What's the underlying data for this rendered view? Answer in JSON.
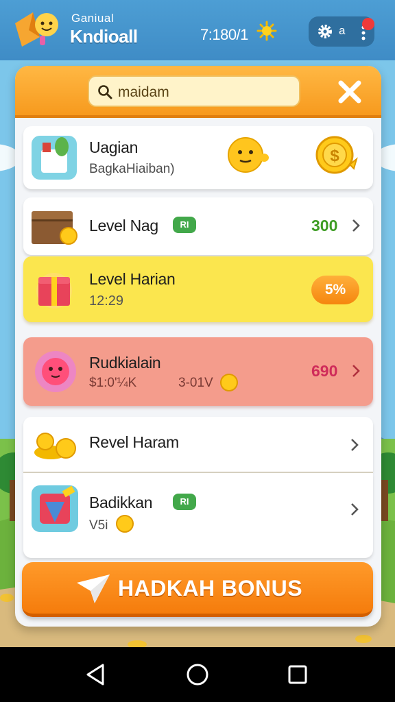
{
  "header": {
    "title_small": "Ganiual",
    "title_big": "Kndioall",
    "coins": "7:180/1",
    "settings_label": "a",
    "icons": [
      "app-logo-icon",
      "sun-icon",
      "gear-icon",
      "more-icon"
    ]
  },
  "panel": {
    "search": {
      "value": "maidam",
      "icon": "search-icon"
    },
    "close_icon": "close-icon",
    "items": [
      {
        "title": "Uagian",
        "subtitle": "BagkaHiaiban)",
        "style": "white",
        "icons": [
          "cup-icon",
          "smiley-icon",
          "coin-icon"
        ]
      },
      {
        "title": "Level Nag",
        "badge": "RI",
        "value": "300",
        "value_color": "#3e9d24",
        "style": "white",
        "icons": [
          "chest-icon",
          "chevron-right-icon"
        ]
      },
      {
        "title": "Level Harian",
        "subtitle": "12:29",
        "pill": "5%",
        "style": "yellow",
        "icons": [
          "gift-icon"
        ]
      },
      {
        "title": "Rudkialain",
        "subtitle": "$1:0'¼K",
        "subtitle2": "3-01V",
        "value": "690",
        "value_color": "#cf2b5a",
        "style": "salmon",
        "icons": [
          "flower-icon",
          "coin-icon",
          "chevron-right-icon"
        ]
      },
      {
        "title": "Revel Haram",
        "style": "white",
        "icons": [
          "coins-icon",
          "chevron-right-icon"
        ]
      },
      {
        "title": "Badikkan",
        "badge": "RI",
        "subtitle": "V5i",
        "style": "white",
        "icons": [
          "card-icon",
          "coin-icon",
          "chevron-right-icon"
        ]
      }
    ],
    "bonus_button": {
      "label": "HADKAH BONUS",
      "icon": "send-icon"
    }
  },
  "navbar": {
    "icons": [
      "back-icon",
      "home-icon",
      "recents-icon"
    ]
  },
  "colors": {
    "accent": "#f79a1e",
    "header": "#3f8cc6",
    "badge": "#42a84a"
  }
}
